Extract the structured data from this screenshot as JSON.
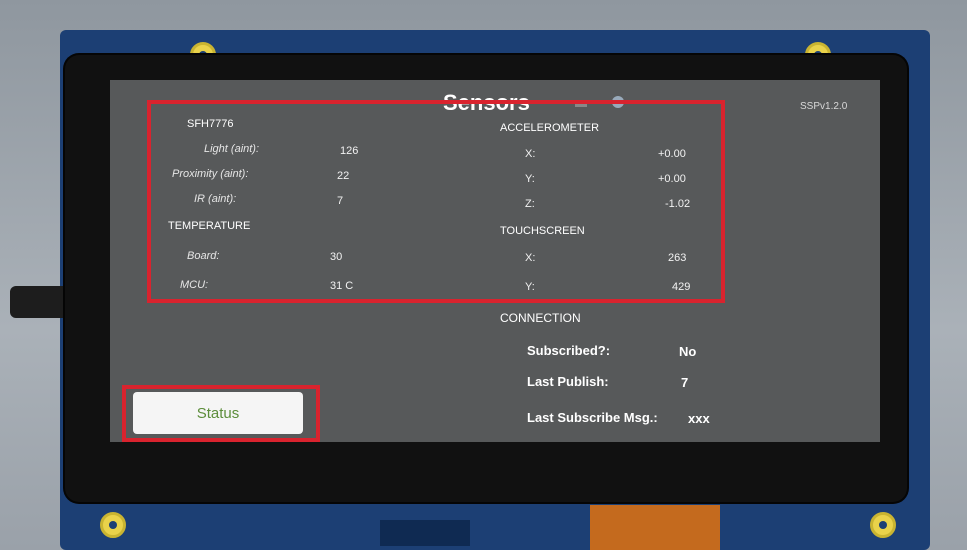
{
  "screen": {
    "title": "Sensors",
    "version": "SSPv1.2.0"
  },
  "sfh": {
    "header": "SFH7776",
    "rows": [
      {
        "label": "Light (aint):",
        "value": "126"
      },
      {
        "label": "Proximity (aint):",
        "value": "22"
      },
      {
        "label": "IR (aint):",
        "value": "7"
      }
    ]
  },
  "temperature": {
    "header": "TEMPERATURE",
    "rows": [
      {
        "label": "Board:",
        "value": "30"
      },
      {
        "label": "MCU:",
        "value": "31 C"
      }
    ]
  },
  "accelerometer": {
    "header": "ACCELEROMETER",
    "rows": [
      {
        "label": "X:",
        "value": "+0.00"
      },
      {
        "label": "Y:",
        "value": "+0.00"
      },
      {
        "label": "Z:",
        "value": "-1.02"
      }
    ]
  },
  "touchscreen": {
    "header": "TOUCHSCREEN",
    "rows": [
      {
        "label": "X:",
        "value": "263"
      },
      {
        "label": "Y:",
        "value": "429"
      }
    ]
  },
  "connection": {
    "header": "CONNECTION",
    "rows": [
      {
        "label": "Subscribed?:",
        "value": "No"
      },
      {
        "label": "Last Publish:",
        "value": "7"
      },
      {
        "label": "Last Subscribe Msg.:",
        "value": "xxx"
      }
    ]
  },
  "status_button": {
    "label": "Status"
  },
  "colors": {
    "highlight": "#d9232e",
    "pcb": "#1c3f74",
    "screen": "#57595a"
  }
}
